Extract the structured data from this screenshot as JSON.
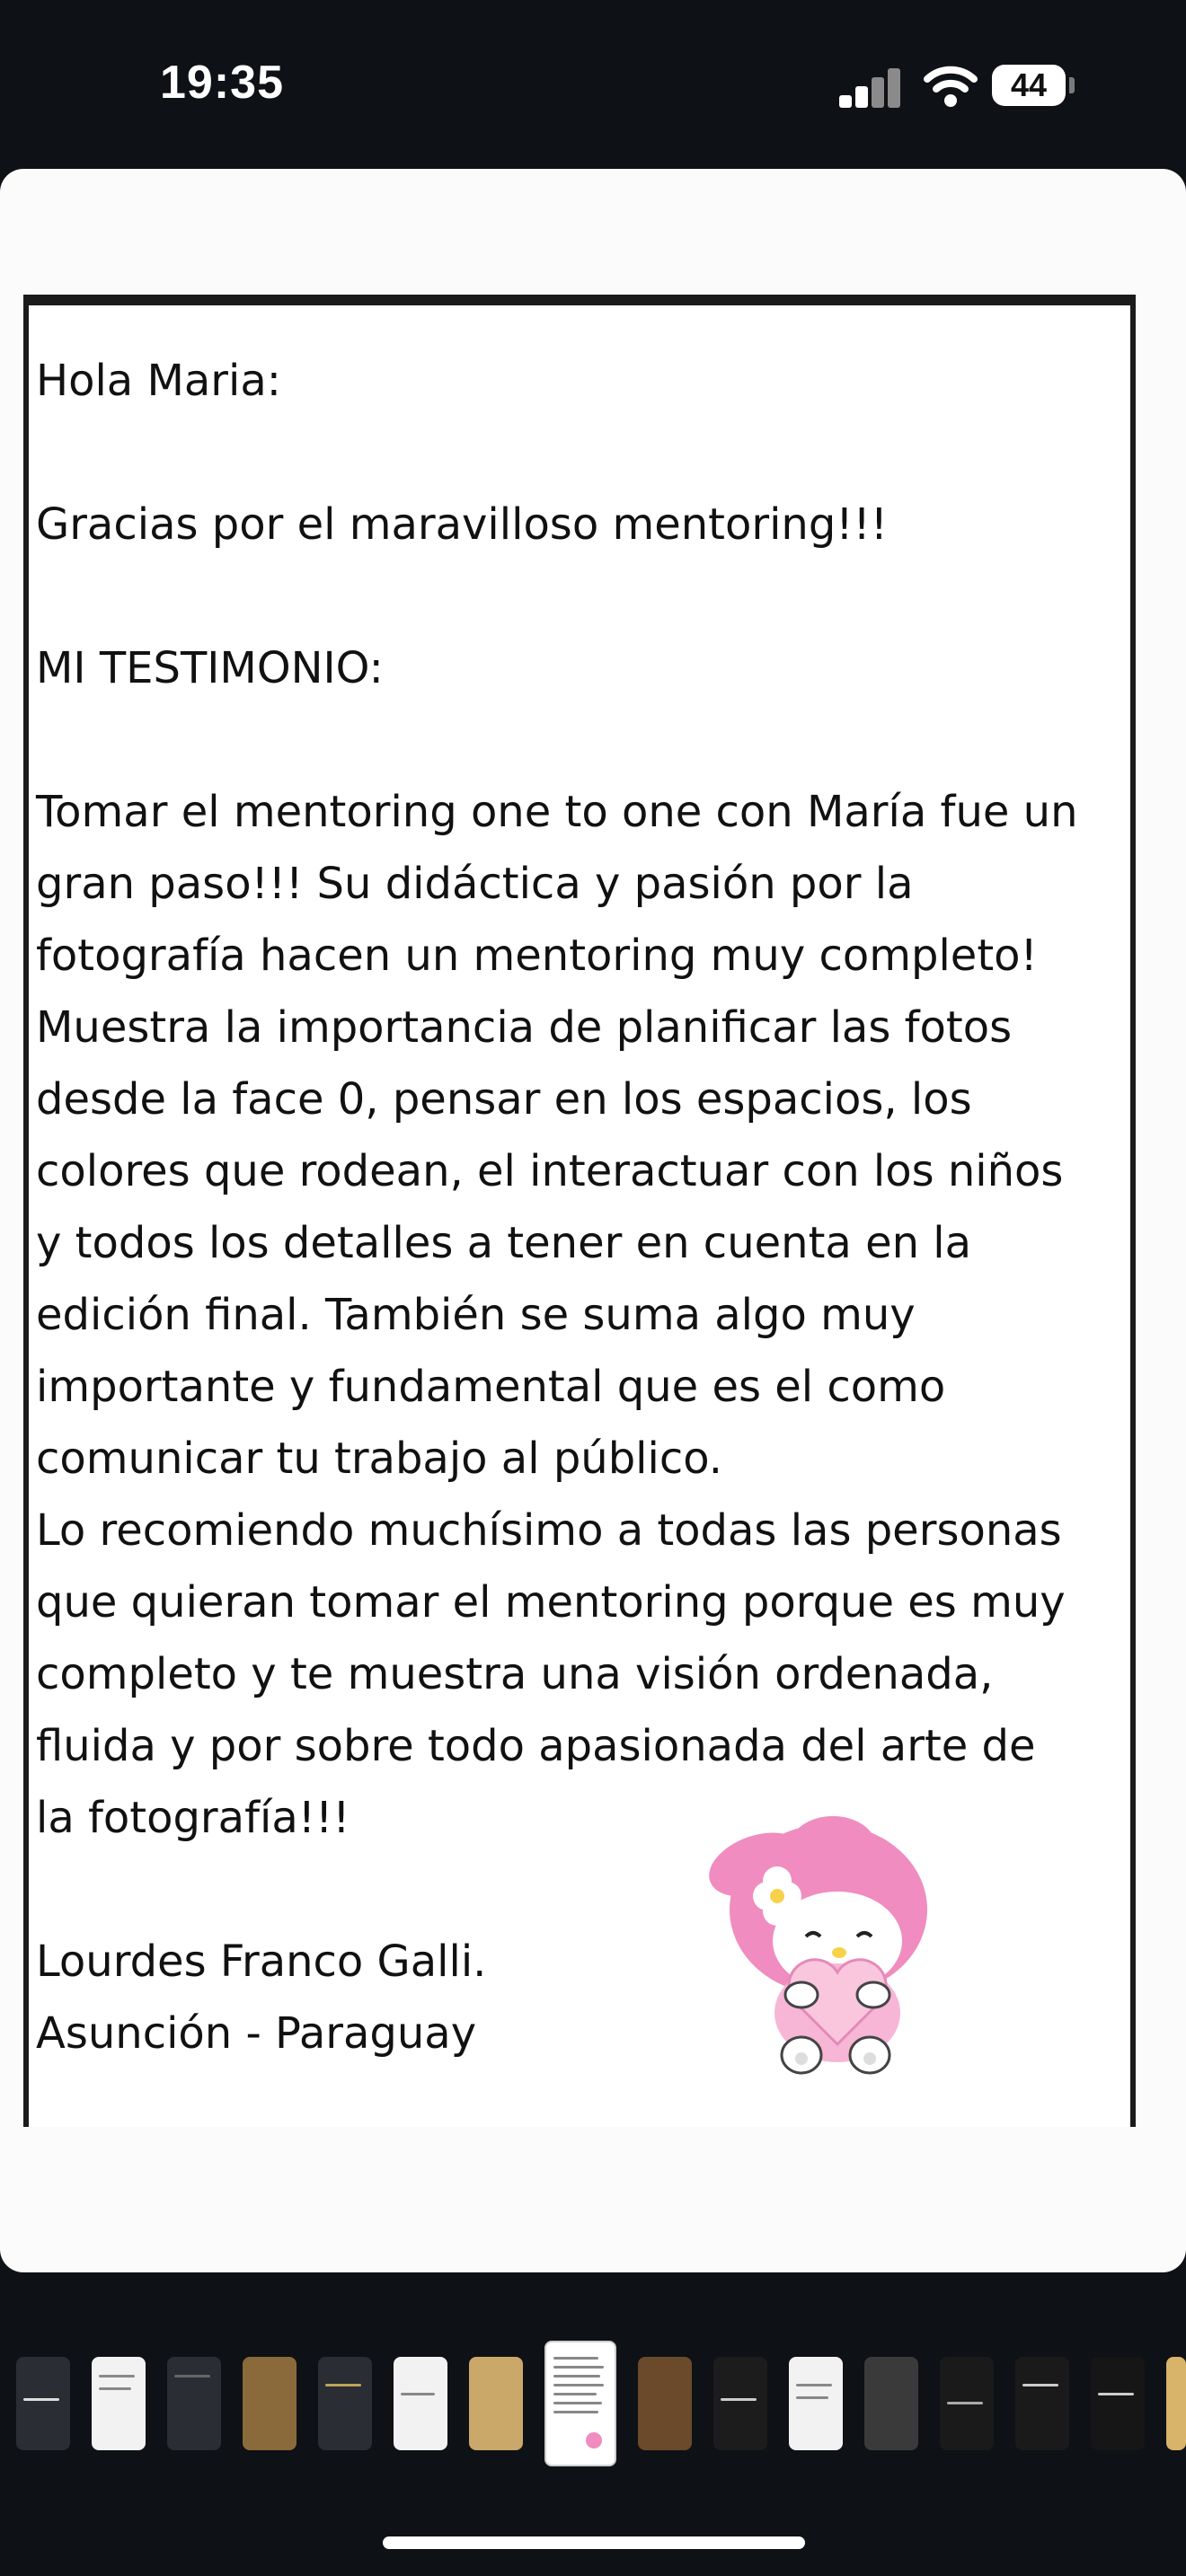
{
  "status_bar": {
    "time": "19:35",
    "battery": "44"
  },
  "document": {
    "greeting": "Hola Maria:",
    "thanks": "Gracias por el maravilloso mentoring!!!",
    "heading": "MI TESTIMONIO:",
    "body_lines": [
      "Tomar el mentoring one to one con María fue un",
      "gran paso!!! Su didáctica y pasión por la",
      "fotografía hacen un mentoring muy completo!",
      "Muestra la importancia de planificar las fotos",
      "desde la face 0, pensar en los espacios, los",
      "colores que rodean, el interactuar con los niños",
      "y todos los detalles a tener en cuenta en la",
      "edición final. También se suma algo muy",
      "importante y fundamental que es el como",
      "comunicar tu trabajo al público.",
      "Lo recomiendo muchísimo a todas las personas",
      "que quieran tomar el mentoring porque es muy",
      "completo y te muestra una visión ordenada,",
      "fluida y por sobre todo apasionada del arte de",
      "la fotografía!!!"
    ],
    "signature_name": "Lourdes Franco Galli.",
    "signature_place": "Asunción - Paraguay",
    "sticker": "my-melody-sticker"
  },
  "thumbnails": {
    "count": 16,
    "selected_index": 7
  },
  "colors": {
    "background": "#0e1115",
    "sheet": "#fbfbfb",
    "sticker_pink": "#f08cbf"
  }
}
